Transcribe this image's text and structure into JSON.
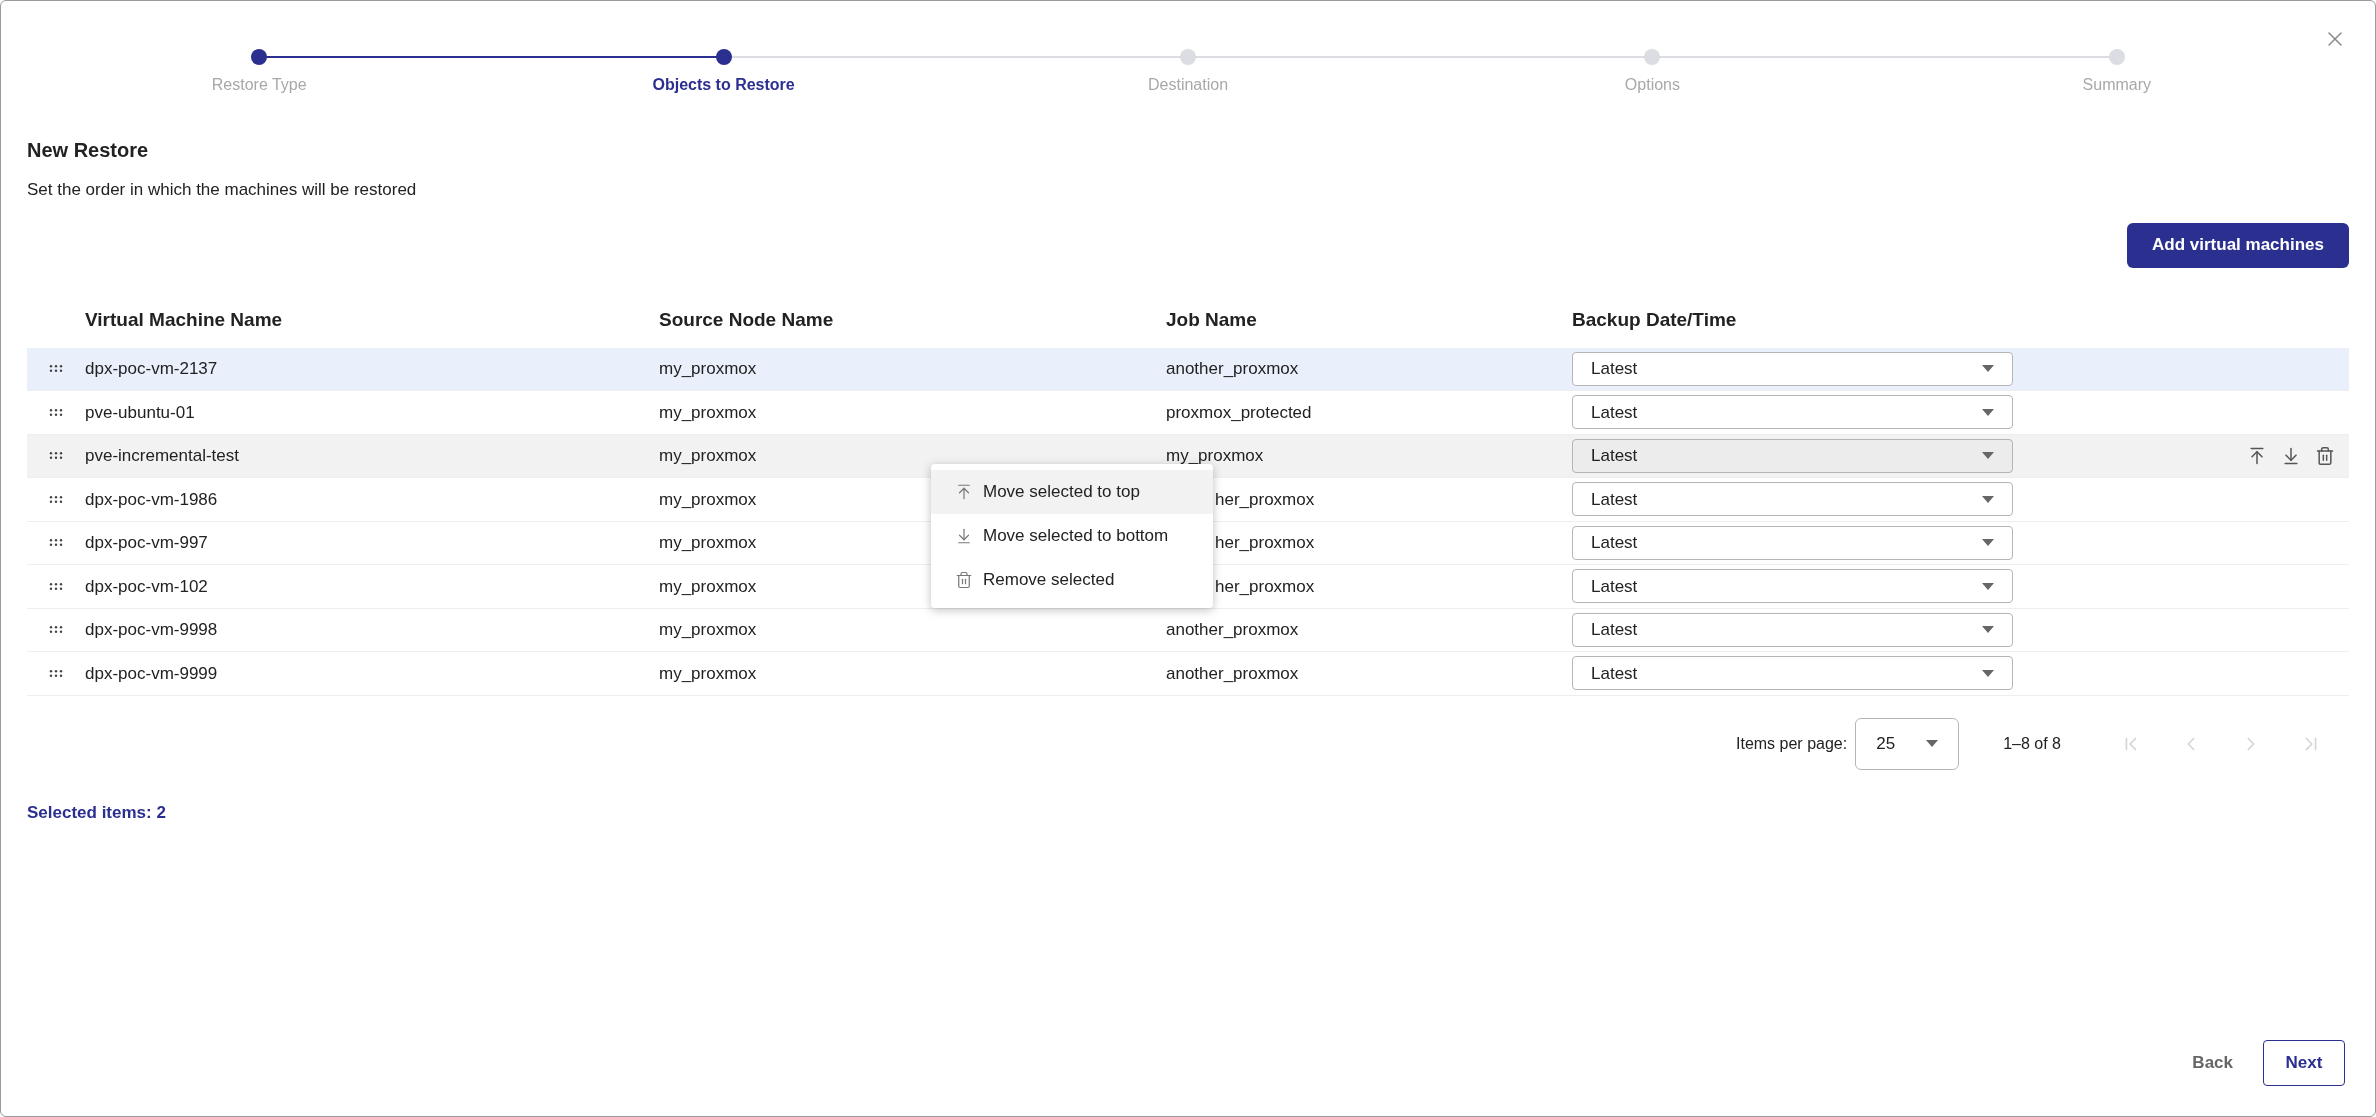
{
  "stepper": [
    {
      "label": "Restore Type",
      "done": true,
      "selected": false
    },
    {
      "label": "Objects to Restore",
      "done": true,
      "selected": true
    },
    {
      "label": "Destination",
      "done": false,
      "selected": false
    },
    {
      "label": "Options",
      "done": false,
      "selected": false
    },
    {
      "label": "Summary",
      "done": false,
      "selected": false
    }
  ],
  "title": "New Restore",
  "subtitle": "Set the order in which the machines will be restored",
  "add_button": "Add virtual machines",
  "table": {
    "columns": [
      "Virtual Machine Name",
      "Source Node Name",
      "Job Name",
      "Backup Date/Time"
    ],
    "rows": [
      {
        "vm": "dpx-poc-vm-2137",
        "node": "my_proxmox",
        "job": "another_proxmox",
        "backup": "Latest",
        "selected": true,
        "hovered": false
      },
      {
        "vm": "pve-ubuntu-01",
        "node": "my_proxmox",
        "job": "proxmox_protected",
        "backup": "Latest",
        "selected": false,
        "hovered": false
      },
      {
        "vm": "pve-incremental-test",
        "node": "my_proxmox",
        "job": "my_proxmox",
        "backup": "Latest",
        "selected": false,
        "hovered": true
      },
      {
        "vm": "dpx-poc-vm-1986",
        "node": "my_proxmox",
        "job": "her_proxmox",
        "job_covered": true,
        "backup": "Latest",
        "selected": false,
        "hovered": false
      },
      {
        "vm": "dpx-poc-vm-997",
        "node": "my_proxmox",
        "job": "her_proxmox",
        "job_covered": true,
        "backup": "Latest",
        "selected": false,
        "hovered": false
      },
      {
        "vm": "dpx-poc-vm-102",
        "node": "my_proxmox",
        "job": "her_proxmox",
        "job_covered": true,
        "backup": "Latest",
        "selected": false,
        "hovered": false
      },
      {
        "vm": "dpx-poc-vm-9998",
        "node": "my_proxmox",
        "job": "another_proxmox",
        "backup": "Latest",
        "selected": false,
        "hovered": false
      },
      {
        "vm": "dpx-poc-vm-9999",
        "node": "my_proxmox",
        "job": "another_proxmox",
        "backup": "Latest",
        "selected": false,
        "hovered": false
      }
    ]
  },
  "context_menu": {
    "items": [
      {
        "kind": "move_top",
        "label": "Move selected to top",
        "hovered": true
      },
      {
        "kind": "move_bottom",
        "label": "Move selected to bottom",
        "hovered": false
      },
      {
        "kind": "remove",
        "label": "Remove selected",
        "hovered": false
      }
    ]
  },
  "pagination": {
    "label": "Items per page:",
    "page_size": "25",
    "range": "1–8 of 8",
    "first_disabled": true,
    "prev_disabled": true,
    "next_disabled": true,
    "last_disabled": true
  },
  "selected_count": "Selected items: 2",
  "footer": {
    "back": "Back",
    "next": "Next"
  }
}
